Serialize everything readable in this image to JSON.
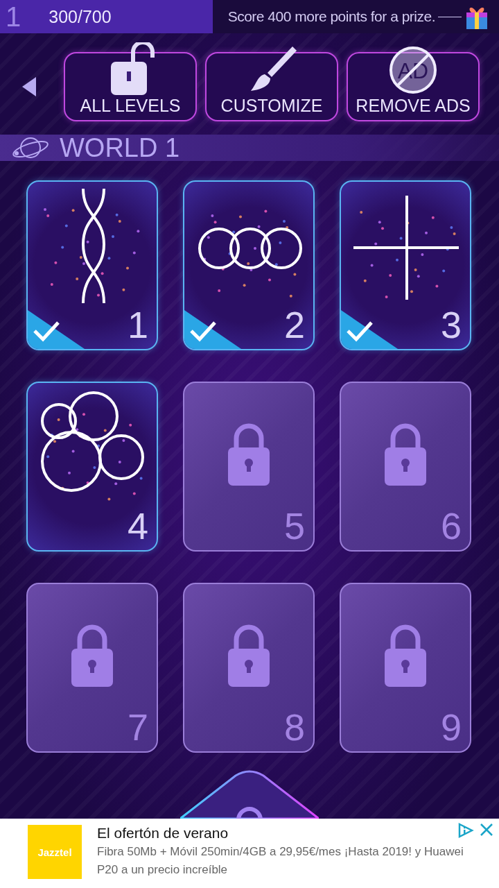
{
  "top_bar": {
    "rank": "1",
    "score": "300/700",
    "prize_message": "Score 400 more points for a prize."
  },
  "menu_buttons": [
    {
      "kind": "unlock",
      "label": "ALL LEVELS"
    },
    {
      "kind": "brush",
      "label": "CUSTOMIZE"
    },
    {
      "kind": "noads",
      "label": "REMOVE ADS",
      "icon_text": "AD"
    }
  ],
  "world": {
    "title": "WORLD 1"
  },
  "levels": [
    {
      "number": "1",
      "kind": "helix",
      "completed": true,
      "locked": false
    },
    {
      "number": "2",
      "kind": "rings",
      "completed": true,
      "locked": false
    },
    {
      "number": "3",
      "kind": "cross",
      "completed": true,
      "locked": false
    },
    {
      "number": "4",
      "kind": "circles",
      "completed": false,
      "locked": false
    },
    {
      "number": "5",
      "kind": "lock",
      "completed": false,
      "locked": true
    },
    {
      "number": "6",
      "kind": "lock",
      "completed": false,
      "locked": true
    },
    {
      "number": "7",
      "kind": "lock",
      "completed": false,
      "locked": true
    },
    {
      "number": "8",
      "kind": "lock",
      "completed": false,
      "locked": true
    },
    {
      "number": "9",
      "kind": "lock",
      "completed": false,
      "locked": true
    }
  ],
  "ad": {
    "brand": "Jazztel",
    "title": "El ofertón de verano",
    "body": "Fibra 50Mb + Móvil 250min/4GB a 29,95€/mes ¡Hasta 2019! y Huawei P20 a un precio increíble"
  }
}
